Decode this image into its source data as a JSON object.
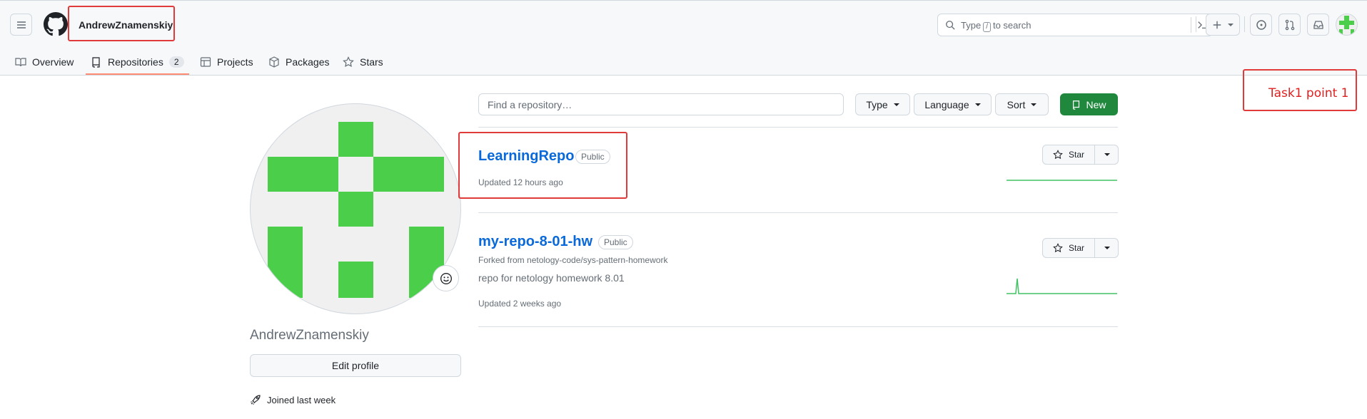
{
  "header": {
    "username": "AndrewZnamenskiy",
    "search_placeholder_pre": "Type",
    "search_placeholder_key": "/",
    "search_placeholder_post": "to search"
  },
  "tabs": [
    {
      "label": "Overview"
    },
    {
      "label": "Repositories",
      "count": "2"
    },
    {
      "label": "Projects"
    },
    {
      "label": "Packages"
    },
    {
      "label": "Stars"
    }
  ],
  "annotation": {
    "text": "Task1 point 1"
  },
  "profile": {
    "fullname": "AndrewZnamenskiy",
    "edit_label": "Edit profile",
    "joined": "Joined last week"
  },
  "filters": {
    "find_placeholder": "Find a repository…",
    "type_label": "Type",
    "language_label": "Language",
    "sort_label": "Sort",
    "new_label": "New"
  },
  "repos": [
    {
      "name": "LearningRepo",
      "visibility": "Public",
      "updated": "Updated 12 hours ago",
      "star_label": "Star"
    },
    {
      "name": "my-repo-8-01-hw",
      "visibility": "Public",
      "forked_from": "Forked from netology-code/sys-pattern-homework",
      "description": "repo for netology homework 8.01",
      "updated": "Updated 2 weeks ago",
      "star_label": "Star"
    }
  ],
  "colors": {
    "accent_green": "#1f883d",
    "link_blue": "#0969da",
    "annotation_red": "#e03a3a",
    "avatar_green": "#4bcf4b",
    "tab_underline": "#fd8c73"
  }
}
